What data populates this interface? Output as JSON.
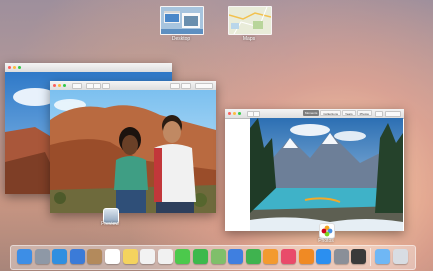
{
  "spaces": {
    "desktop_label": "Desktop",
    "maps_label": "Maps"
  },
  "windows": {
    "preview_label": "Preview",
    "photos_label": "Photos",
    "photos_toolbar_tabs": [
      "Moments",
      "Collections",
      "Years",
      "Photos"
    ]
  },
  "dock": {
    "items": [
      {
        "name": "finder-icon",
        "color": "#3d8ee6"
      },
      {
        "name": "launchpad-icon",
        "color": "#8e98a6"
      },
      {
        "name": "safari-icon",
        "color": "#2f8fe0"
      },
      {
        "name": "mail-icon",
        "color": "#3b7bd8"
      },
      {
        "name": "contacts-icon",
        "color": "#b38a5c"
      },
      {
        "name": "calendar-icon",
        "color": "#ffffff"
      },
      {
        "name": "notes-icon",
        "color": "#f4d35e"
      },
      {
        "name": "reminders-icon",
        "color": "#f2f2f2"
      },
      {
        "name": "photos-icon",
        "color": "#f1f1f1"
      },
      {
        "name": "messages-icon",
        "color": "#4cc94c"
      },
      {
        "name": "facetime-icon",
        "color": "#3cb94c"
      },
      {
        "name": "maps-icon",
        "color": "#7fbf6a"
      },
      {
        "name": "keynote-icon",
        "color": "#3f7fe0"
      },
      {
        "name": "numbers-icon",
        "color": "#3fb34f"
      },
      {
        "name": "pages-icon",
        "color": "#f39a2f"
      },
      {
        "name": "itunes-icon",
        "color": "#e94b6a"
      },
      {
        "name": "ibooks-icon",
        "color": "#f08a24"
      },
      {
        "name": "app-store-icon",
        "color": "#2b8ff0"
      },
      {
        "name": "system-preferences-icon",
        "color": "#8a8f98"
      },
      {
        "name": "quicktime-icon",
        "color": "#3a3a3a"
      },
      {
        "name": "downloads-folder-icon",
        "color": "#6fb7f5"
      },
      {
        "name": "trash-icon",
        "color": "#d8dde3"
      }
    ]
  }
}
